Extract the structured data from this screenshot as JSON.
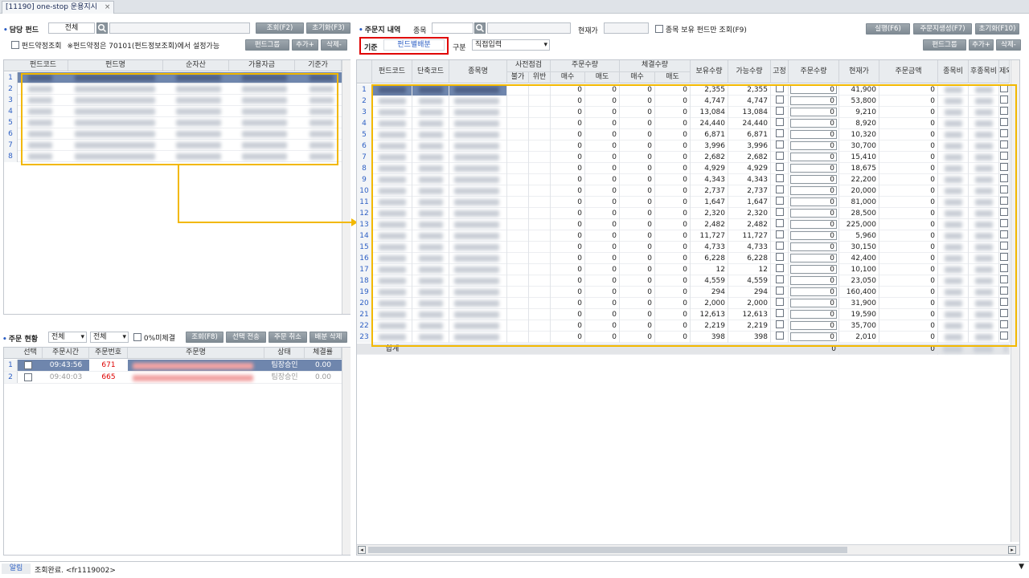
{
  "window": {
    "tab_title": "[11190] one-stop 운용지시",
    "close": "×"
  },
  "left": {
    "fund_label": "담당 펀드",
    "fund_select": "전체",
    "query_btn": "조회(F2)",
    "reset_btn": "초기화(F3)",
    "terms_check": "펀드약정조회",
    "terms_note": "※펀드약정은 70101(펀드정보조회)에서 설정가능",
    "group_btn": "펀드그룹",
    "add_btn": "추가+",
    "del_btn": "삭제-",
    "columns": [
      "펀드코드",
      "펀드명",
      "순자산",
      "가용자금",
      "기준가"
    ],
    "row_numbers": [
      "1",
      "2",
      "3",
      "4",
      "5",
      "6",
      "7",
      "8"
    ]
  },
  "orders_status": {
    "title": "주문 현황",
    "select1": "전체",
    "select2": "전체",
    "zero_check": "0%미체결",
    "query_btn": "조회(F8)",
    "send_btn": "선택 전송",
    "cancel_btn": "주문 취소",
    "alloc_del_btn": "배분 삭제",
    "columns": [
      "선택",
      "주문시간",
      "주문번호",
      "주문명",
      "상태",
      "체결률"
    ],
    "rows": [
      {
        "n": "1",
        "time": "09:43:56",
        "no": "671",
        "status": "팀장승인",
        "rate": "0.00"
      },
      {
        "n": "2",
        "time": "09:40:03",
        "no": "665",
        "status": "팀장승인",
        "rate": "0.00"
      }
    ]
  },
  "right": {
    "title": "주문지 내역",
    "stock_label": "종목",
    "price_label": "현재가",
    "hold_check": "종목 보유 펀드만 조회(F9)",
    "exec_btn": "실행(F6)",
    "gen_btn": "주문지생성(F7)",
    "reset_btn": "초기화(F10)",
    "basis_label": "기준",
    "basis_value": "펀드별배분",
    "type_label": "구분",
    "type_value": "직접입력",
    "group_btn": "펀드그룹",
    "add_btn": "추가+",
    "del_btn": "삭제-",
    "header_groups": {
      "pre": "사전점검",
      "order_qty": "주문수량",
      "exec_qty": "체결수량"
    },
    "columns": {
      "fund": "펀드코드",
      "short": "단축코드",
      "name": "종목명",
      "no": "불가",
      "viol": "위반",
      "buy": "매수",
      "sell": "매도",
      "ebuy": "매수",
      "esell": "매도",
      "hold": "보유수량",
      "avail": "가능수량",
      "fix": "고정",
      "oqty": "주문수량",
      "price": "현재가",
      "amt": "주문금액",
      "fee": "종목비",
      "post": "후종목비",
      "excl": "제외"
    },
    "rows": [
      {
        "n": "1",
        "hold": "2,355",
        "avail": "2,355",
        "price": "41,900"
      },
      {
        "n": "2",
        "hold": "4,747",
        "avail": "4,747",
        "price": "53,800"
      },
      {
        "n": "3",
        "hold": "13,084",
        "avail": "13,084",
        "price": "9,210"
      },
      {
        "n": "4",
        "hold": "24,440",
        "avail": "24,440",
        "price": "8,920"
      },
      {
        "n": "5",
        "hold": "6,871",
        "avail": "6,871",
        "price": "10,320"
      },
      {
        "n": "6",
        "hold": "3,996",
        "avail": "3,996",
        "price": "30,700"
      },
      {
        "n": "7",
        "hold": "2,682",
        "avail": "2,682",
        "price": "15,410"
      },
      {
        "n": "8",
        "hold": "4,929",
        "avail": "4,929",
        "price": "18,675"
      },
      {
        "n": "9",
        "hold": "4,343",
        "avail": "4,343",
        "price": "22,200"
      },
      {
        "n": "10",
        "hold": "2,737",
        "avail": "2,737",
        "price": "20,000"
      },
      {
        "n": "11",
        "hold": "1,647",
        "avail": "1,647",
        "price": "81,000"
      },
      {
        "n": "12",
        "hold": "2,320",
        "avail": "2,320",
        "price": "28,500"
      },
      {
        "n": "13",
        "hold": "2,482",
        "avail": "2,482",
        "price": "225,000"
      },
      {
        "n": "14",
        "hold": "11,727",
        "avail": "11,727",
        "price": "5,960"
      },
      {
        "n": "15",
        "hold": "4,733",
        "avail": "4,733",
        "price": "30,150"
      },
      {
        "n": "16",
        "hold": "6,228",
        "avail": "6,228",
        "price": "42,400"
      },
      {
        "n": "17",
        "hold": "12",
        "avail": "12",
        "price": "10,100"
      },
      {
        "n": "18",
        "hold": "4,559",
        "avail": "4,559",
        "price": "23,050"
      },
      {
        "n": "19",
        "hold": "294",
        "avail": "294",
        "price": "160,400"
      },
      {
        "n": "20",
        "hold": "2,000",
        "avail": "2,000",
        "price": "31,900"
      },
      {
        "n": "21",
        "hold": "12,613",
        "avail": "12,613",
        "price": "19,590"
      },
      {
        "n": "22",
        "hold": "2,219",
        "avail": "2,219",
        "price": "35,700"
      },
      {
        "n": "23",
        "hold": "398",
        "avail": "398",
        "price": "2,010"
      }
    ],
    "zero": "0",
    "total_label": "합계",
    "total_qty": "0",
    "total_amt": "0"
  },
  "status": {
    "label": "알림",
    "message": "조회완료. <fr1119002>"
  }
}
